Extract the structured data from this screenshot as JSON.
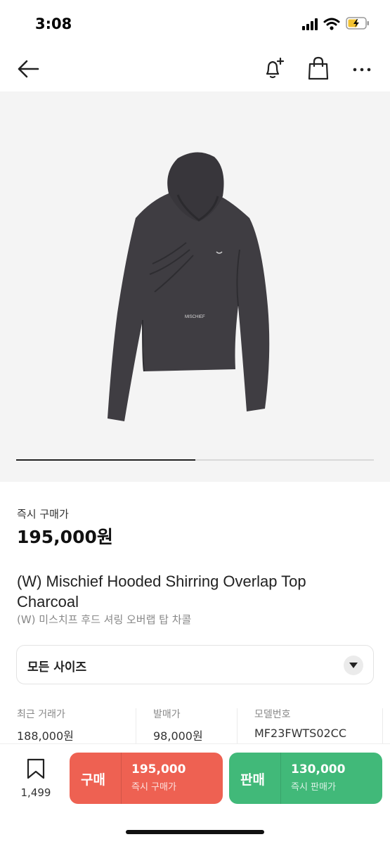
{
  "status_bar": {
    "time": "3:08"
  },
  "product": {
    "price_label": "즉시 구매가",
    "price": "195,000원",
    "title": "(W) Mischief Hooded Shirring Overlap Top Charcoal",
    "subtitle": "(W) 미스치프 후드 셔링 오버랩 탑 차콜",
    "image_logo_text": "MISCHIEF",
    "carousel_progress": 0.5
  },
  "size_selector": {
    "label": "모든 사이즈"
  },
  "stats": [
    {
      "label": "최근 거래가",
      "value": "188,000원"
    },
    {
      "label": "발매가",
      "value": "98,000원"
    },
    {
      "label": "모델번호",
      "value": "MF23FWTS02CC"
    }
  ],
  "action_bar": {
    "wish_count": "1,499",
    "buy": {
      "label": "구매",
      "price": "195,000",
      "sub": "즉시 구매가",
      "color": "#ee6152"
    },
    "sell": {
      "label": "판매",
      "price": "130,000",
      "sub": "즉시 판매가",
      "color": "#41b979"
    }
  },
  "icons": [
    "back-arrow-icon",
    "bell-plus-icon",
    "shopping-bag-icon",
    "more-icon",
    "bookmark-icon",
    "chevron-down-icon"
  ]
}
